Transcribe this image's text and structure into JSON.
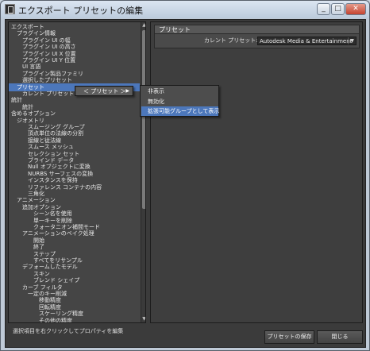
{
  "window": {
    "title": "エクスポート プリセットの編集",
    "minimize_glyph": "_",
    "maximize_glyph": "□",
    "close_glyph": "✕"
  },
  "tree": {
    "items": [
      {
        "label": "エクスポート",
        "indent": 0
      },
      {
        "label": "プラグイン情報",
        "indent": 1
      },
      {
        "label": "プラグイン UI の幅",
        "indent": 2
      },
      {
        "label": "プラグイン UI の高さ",
        "indent": 2
      },
      {
        "label": "プラグイン UI X 位置",
        "indent": 2
      },
      {
        "label": "プラグイン UI Y 位置",
        "indent": 2
      },
      {
        "label": "UI 言語",
        "indent": 2
      },
      {
        "label": "プラグイン製品ファミリ",
        "indent": 2
      },
      {
        "label": "選択したプリセット",
        "indent": 2
      },
      {
        "label": "プリセット",
        "indent": 1,
        "selected": true
      },
      {
        "label": "カレント プリセット",
        "indent": 2
      },
      {
        "label": "統計",
        "indent": 0
      },
      {
        "label": "統計",
        "indent": 2
      },
      {
        "label": "含めるオプション",
        "indent": 0
      },
      {
        "label": "ジオメトリ",
        "indent": 1
      },
      {
        "label": "スムージング グループ",
        "indent": 3
      },
      {
        "label": "頂点単位の法線の分割",
        "indent": 3
      },
      {
        "label": "接線と従法線",
        "indent": 3
      },
      {
        "label": "スムース メッシュ",
        "indent": 3
      },
      {
        "label": "セレクション セット",
        "indent": 3
      },
      {
        "label": "ブラインド データ",
        "indent": 3
      },
      {
        "label": "Null オブジェクトに変換",
        "indent": 3
      },
      {
        "label": "NURBS サーフェスの変換",
        "indent": 3
      },
      {
        "label": "インスタンスを保持",
        "indent": 3
      },
      {
        "label": "リファレンス コンテナの内容",
        "indent": 3
      },
      {
        "label": "三角化",
        "indent": 3
      },
      {
        "label": "アニメーション",
        "indent": 1
      },
      {
        "label": "追加オプション",
        "indent": 2
      },
      {
        "label": "シーン名を使用",
        "indent": 4
      },
      {
        "label": "単一キーを削除",
        "indent": 4
      },
      {
        "label": "クォータニオン補間モード",
        "indent": 4
      },
      {
        "label": "アニメーションのベイク処理",
        "indent": 2
      },
      {
        "label": "開始",
        "indent": 4
      },
      {
        "label": "終了",
        "indent": 4
      },
      {
        "label": "ステップ",
        "indent": 4
      },
      {
        "label": "すべてをリサンプル",
        "indent": 4
      },
      {
        "label": "デフォームしたモデル",
        "indent": 2
      },
      {
        "label": "スキン",
        "indent": 4
      },
      {
        "label": "ブレンド シェイプ",
        "indent": 4
      },
      {
        "label": "カーブ フィルタ",
        "indent": 2
      },
      {
        "label": "一定のキー削減",
        "indent": 3
      },
      {
        "label": "移動精度",
        "indent": 5
      },
      {
        "label": "回転精度",
        "indent": 5
      },
      {
        "label": "スケーリング精度",
        "indent": 5
      },
      {
        "label": "その他の精度",
        "indent": 5
      }
    ]
  },
  "context_menu": {
    "preset_label": "＜ プリセット ＞",
    "submenu_arrow": "▶",
    "submenu": [
      {
        "label": "非表示",
        "highlight": false
      },
      {
        "label": "無効化",
        "highlight": false
      },
      {
        "label": "拡張可能グループとして表示",
        "highlight": true
      }
    ]
  },
  "right_panel": {
    "header": "プリセット",
    "current_preset_label": "カレント プリセット:",
    "current_preset_value": "Autodesk Media & Entertainment",
    "dropdown_arrow": "▼"
  },
  "status": {
    "text": "選択項目を右クリックしてプロパティを編集"
  },
  "buttons": {
    "save_preset": "プリセットの保存",
    "close": "閉じる"
  },
  "scrollbar": {
    "up": "▲",
    "down": "▼"
  }
}
